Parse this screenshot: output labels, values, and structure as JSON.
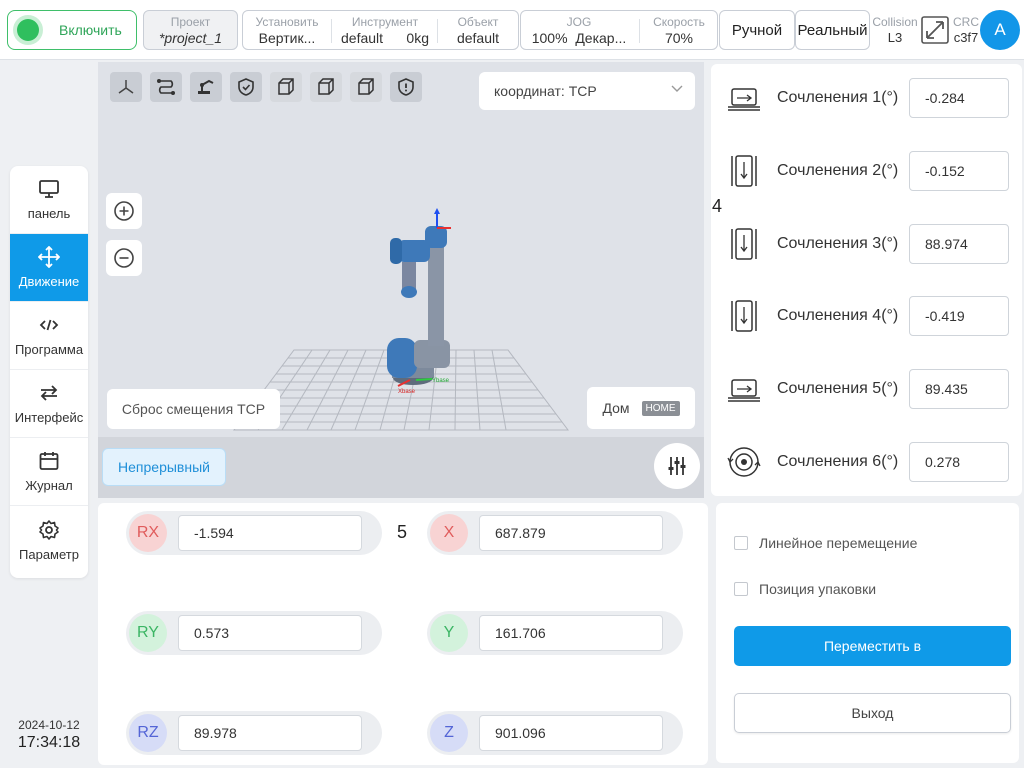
{
  "topbar": {
    "power_label": "Включить",
    "project": {
      "label": "Проект",
      "value": "*project_1"
    },
    "install": {
      "label": "Установить",
      "value": "Вертик..."
    },
    "tool": {
      "label": "Инструмент",
      "value": "default",
      "weight": "0kg"
    },
    "object": {
      "label": "Объект",
      "value": "default"
    },
    "jog": {
      "label": "JOG",
      "percent": "100%",
      "frame": "Декар..."
    },
    "speed": {
      "label": "Скорость",
      "value": "70%"
    },
    "mode_manual": "Ручной",
    "mode_real": "Реальный",
    "collision": {
      "label": "Collision",
      "value": "L3"
    },
    "crc": {
      "label": "CRC",
      "value": "c3f7"
    },
    "avatar_letter": "A",
    "colors": {
      "accent": "#0f9ae8",
      "power": "#2fbf5e"
    }
  },
  "sidebar": {
    "items": [
      {
        "label": "панель",
        "icon": "monitor-icon"
      },
      {
        "label": "Движение",
        "icon": "move-arrows-icon",
        "active": true
      },
      {
        "label": "Программа",
        "icon": "code-icon"
      },
      {
        "label": "Интерфейс",
        "icon": "swap-arrows-icon"
      },
      {
        "label": "Журнал",
        "icon": "calendar-icon"
      },
      {
        "label": "Параметр",
        "icon": "gear-icon"
      }
    ],
    "date": "2024-10-12",
    "time": "17:34:18"
  },
  "viewport": {
    "coord_select": "координат: TCP",
    "reset_label": "Сброс смещения TCP",
    "home_label": "Дом",
    "home_tag": "HOME",
    "continuous_label": "Непрерывный",
    "axis_label_x": "Xbase",
    "axis_label_y": "Ybase"
  },
  "joints": {
    "marker": "4",
    "items": [
      {
        "label": "Сочленения 1(°)",
        "value": "-0.284"
      },
      {
        "label": "Сочленения 2(°)",
        "value": "-0.152"
      },
      {
        "label": "Сочленения 3(°)",
        "value": "88.974"
      },
      {
        "label": "Сочленения 4(°)",
        "value": "-0.419"
      },
      {
        "label": "Сочленения 5(°)",
        "value": "89.435"
      },
      {
        "label": "Сочленения 6(°)",
        "value": "0.278"
      }
    ]
  },
  "cartesian": {
    "marker": "5",
    "rx": {
      "label": "RX",
      "value": "-1.594"
    },
    "ry": {
      "label": "RY",
      "value": "0.573"
    },
    "rz": {
      "label": "RZ",
      "value": "89.978"
    },
    "x": {
      "label": "X",
      "value": "687.879"
    },
    "y": {
      "label": "Y",
      "value": "161.706"
    },
    "z": {
      "label": "Z",
      "value": "901.096"
    }
  },
  "move": {
    "linear_label": "Линейное перемещение",
    "pack_label": "Позиция упаковки",
    "move_to_label": "Переместить в",
    "exit_label": "Выход"
  }
}
